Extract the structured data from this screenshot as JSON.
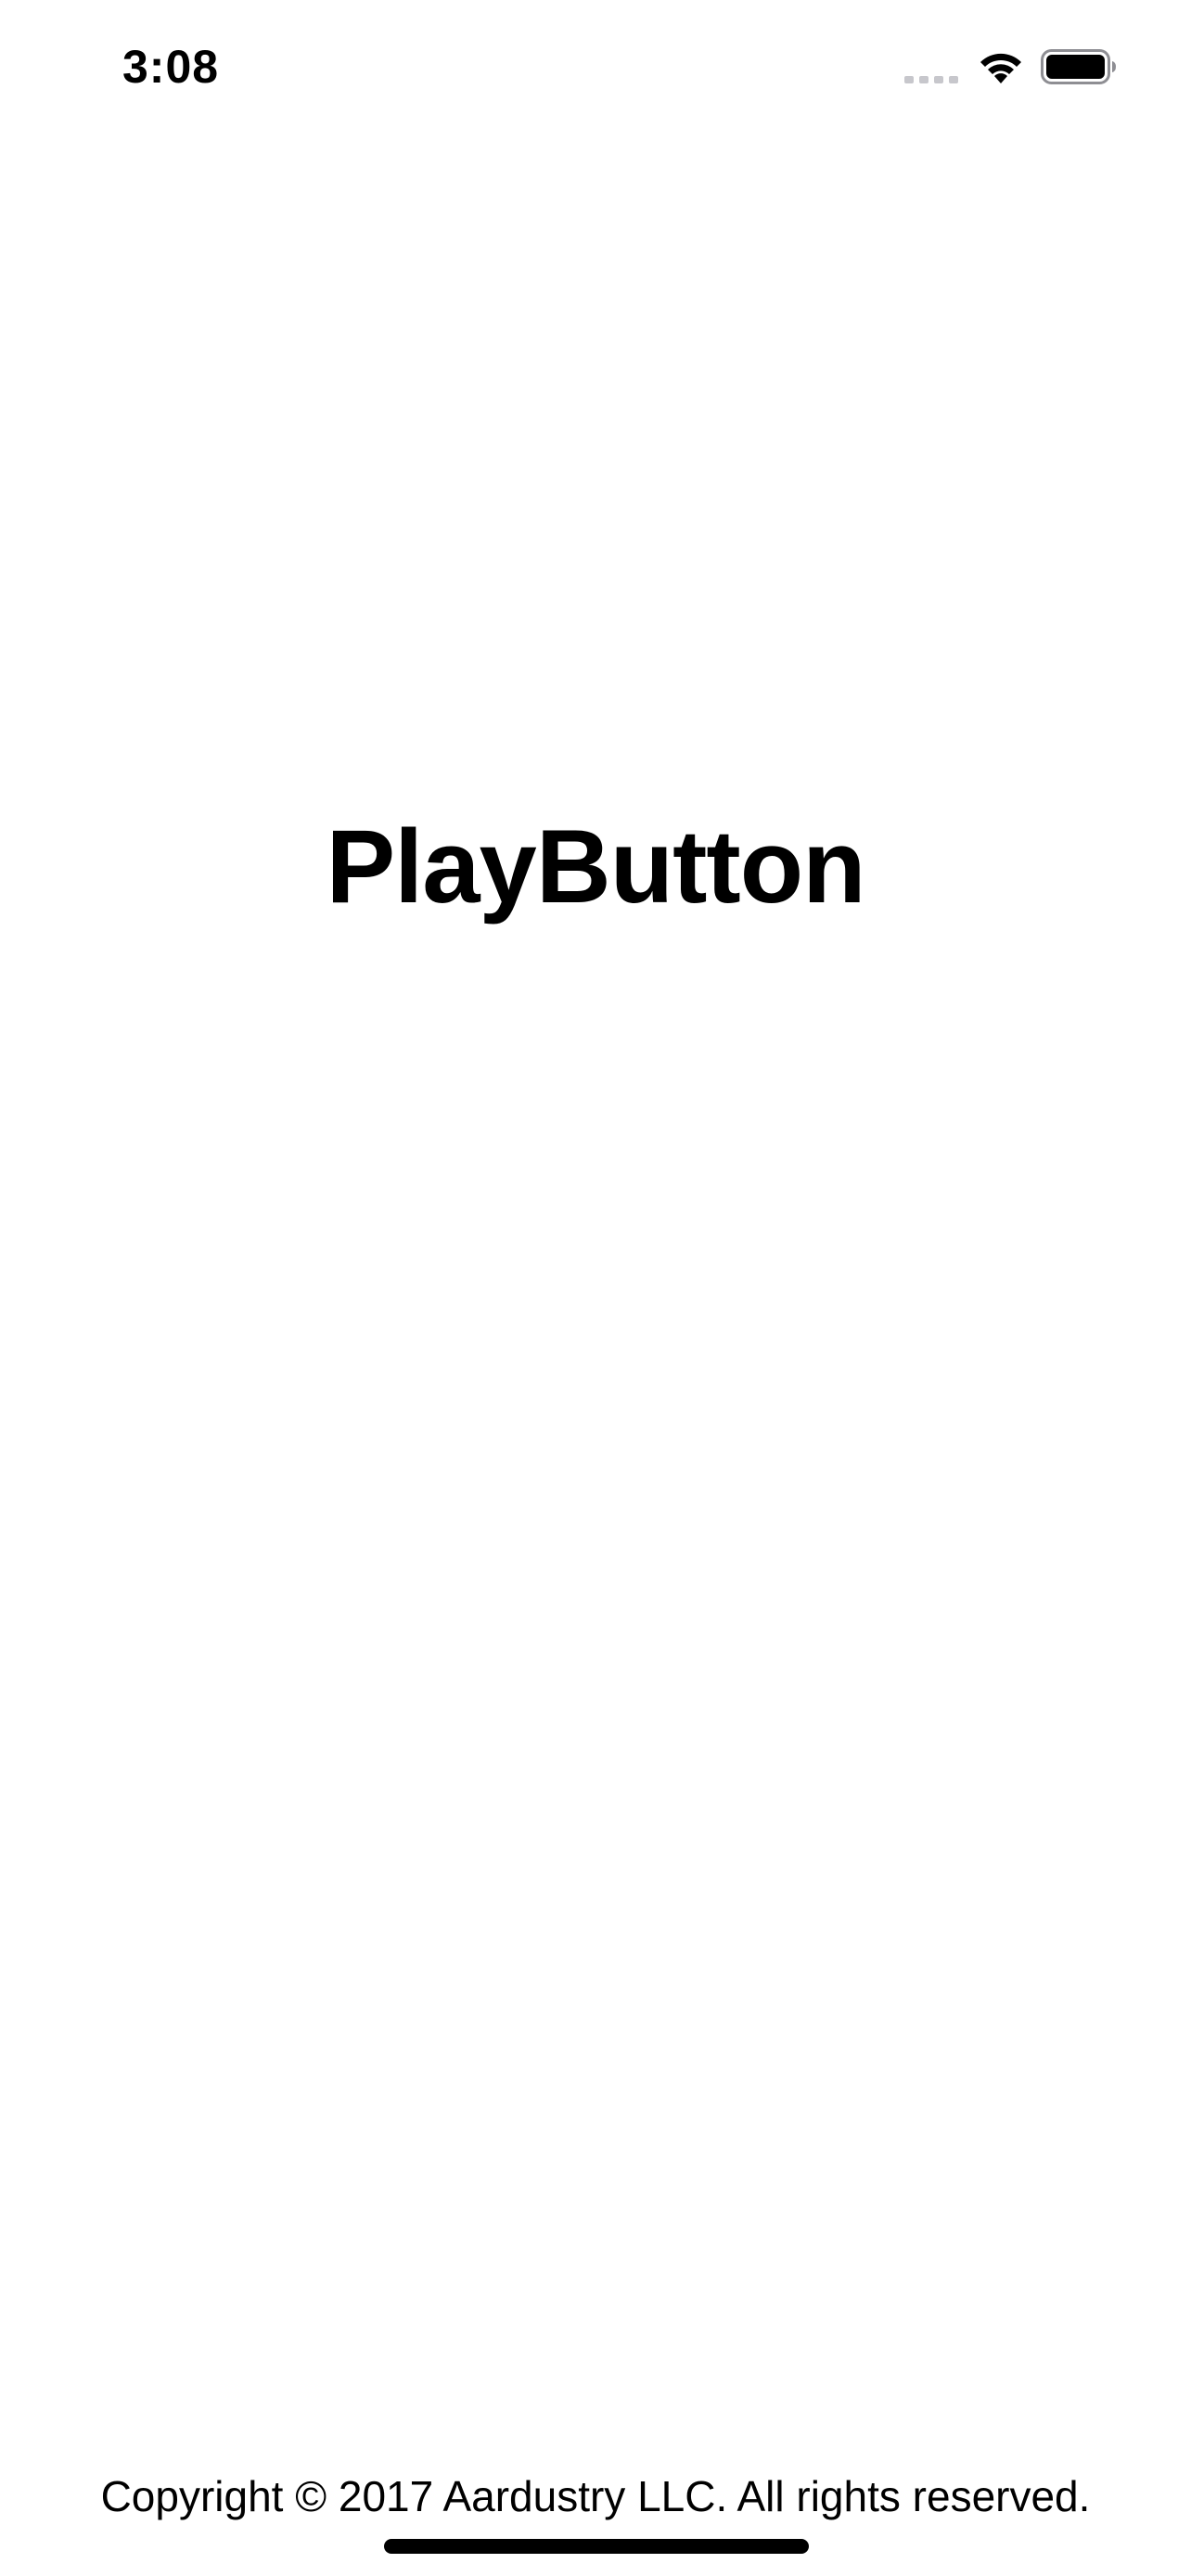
{
  "status_bar": {
    "time": "3:08",
    "signal_icon": "cellular-signal-icon",
    "wifi_icon": "wifi-icon",
    "battery_icon": "battery-icon",
    "battery_level": 1.0
  },
  "splash": {
    "title": "PlayButton"
  },
  "footer": {
    "copyright": "Copyright © 2017 Aardustry LLC. All rights reserved."
  },
  "colors": {
    "background": "#ffffff",
    "text": "#000000",
    "signal_inactive": "#c7c7cc"
  }
}
